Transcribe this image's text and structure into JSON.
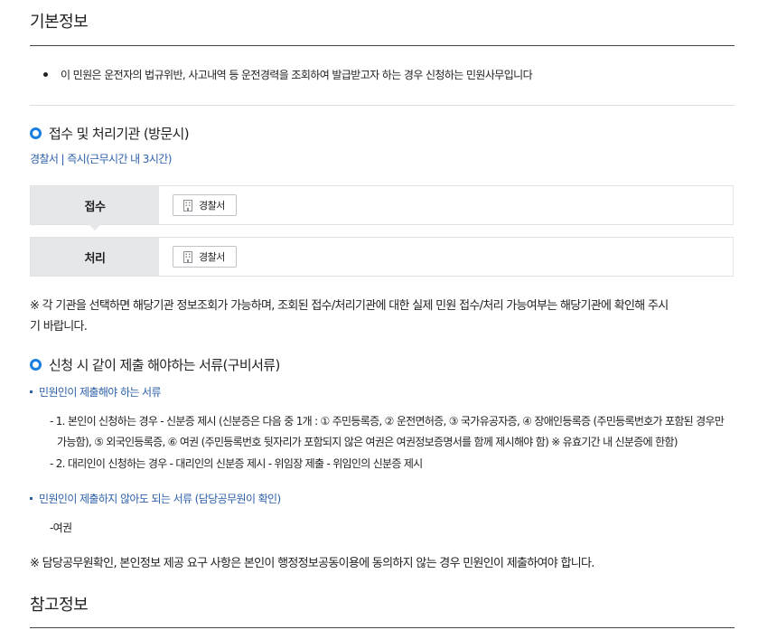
{
  "basic_info": {
    "title": "기본정보",
    "intro": "이 민원은 운전자의 법규위반, 사고내역 등 운전경력을 조회하여 발급받고자 하는 경우 신청하는 민원사무입니다"
  },
  "agency": {
    "heading": "접수 및 처리기관 (방문시)",
    "note": "경찰서 | 즉시(근무시간 내 3시간)",
    "rows": [
      {
        "label": "접수",
        "button": "경찰서"
      },
      {
        "label": "처리",
        "button": "경찰서"
      }
    ],
    "disclaimer_line1": "※ 각 기관을 선택하면 해당기관 정보조회가 가능하며, 조회된 접수/처리기관에 대한 실제 민원 접수/처리 가능여부는 해당기관에 확인해 주시",
    "disclaimer_line2": "기 바랍니다."
  },
  "documents": {
    "heading": "신청 시 같이 제출 해야하는 서류(구비서류)",
    "required_title": "민원인이 제출해야 하는 서류",
    "required_items": {
      "item1_line1": "- 1. 본인이 신청하는 경우 - 신분증 제시 (신분증은 다음 중 1개 : ① 주민등록증, ② 운전면허증, ③ 국가유공자증, ④ 장애인등록증 (주민등록번호가 포함된 경우만",
      "item1_line2": "가능함), ⑤ 외국인등록증, ⑥ 여권 (주민등록번호 뒷자리가 포함되지 않은 여권은 여권정보증명서를 함께 제시해야 함) ※ 유효기간 내 신분증에 한함)",
      "item2": "- 2. 대리인이 신청하는 경우 - 대리인의 신분증 제시 - 위임장 제출 - 위임인의 신분증 제시"
    },
    "optional_title": "민원인이 제출하지 않아도 되는 서류 (담당공무원이 확인)",
    "optional_item": "-여권",
    "footnote": "※ 담당공무원확인, 본인정보 제공 요구 사항은 본인이 행정정보공동이용에 동의하지 않는 경우 민원인이 제출하여야 합니다."
  },
  "reference": {
    "title": "참고정보"
  },
  "colors": {
    "accent_blue": "#1a7ee0",
    "link_blue": "#2c5fa8",
    "label_bg": "#e6e7ea"
  },
  "icons": {
    "heading_marker": "ring-icon",
    "org_button": "building-icon",
    "list_marker": "bullet-dot-icon"
  }
}
